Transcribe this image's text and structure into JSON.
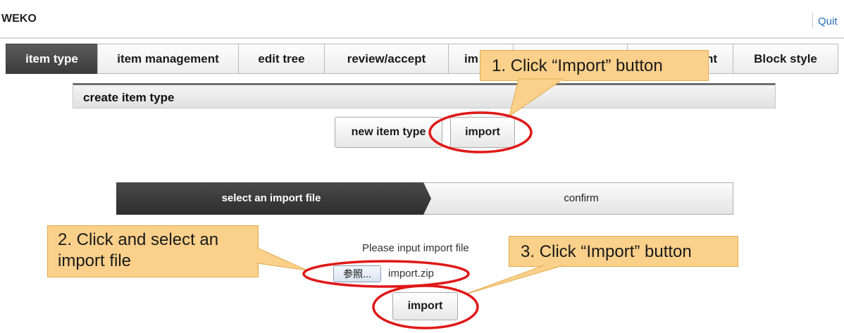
{
  "header": {
    "app_title": "WEKO",
    "quit_label": "Quit"
  },
  "tabs": [
    {
      "label": "item type"
    },
    {
      "label": "item management"
    },
    {
      "label": "edit tree"
    },
    {
      "label": "review/accept"
    },
    {
      "label": "im"
    },
    {
      "label": ""
    },
    {
      "label": "ent"
    },
    {
      "label": "Block style"
    }
  ],
  "section": {
    "title": "create item type"
  },
  "actions": {
    "new_item_type_label": "new item type",
    "import_label": "import"
  },
  "wizard": {
    "step1": "select an import file",
    "step2": "confirm"
  },
  "upload": {
    "prompt": "Please input import file",
    "browse_label": "参照...",
    "file_name": "import.zip",
    "submit_label": "import"
  },
  "annotations": {
    "callout1": "1. Click “Import” button",
    "callout2": "2. Click and select an import file",
    "callout3": "3. Click “Import” button"
  },
  "colors": {
    "callout_fill": "#fbd08a",
    "highlight_ring": "#e01818",
    "active_tab": "#3b3b3b",
    "active_step": "#3a3a3a"
  }
}
